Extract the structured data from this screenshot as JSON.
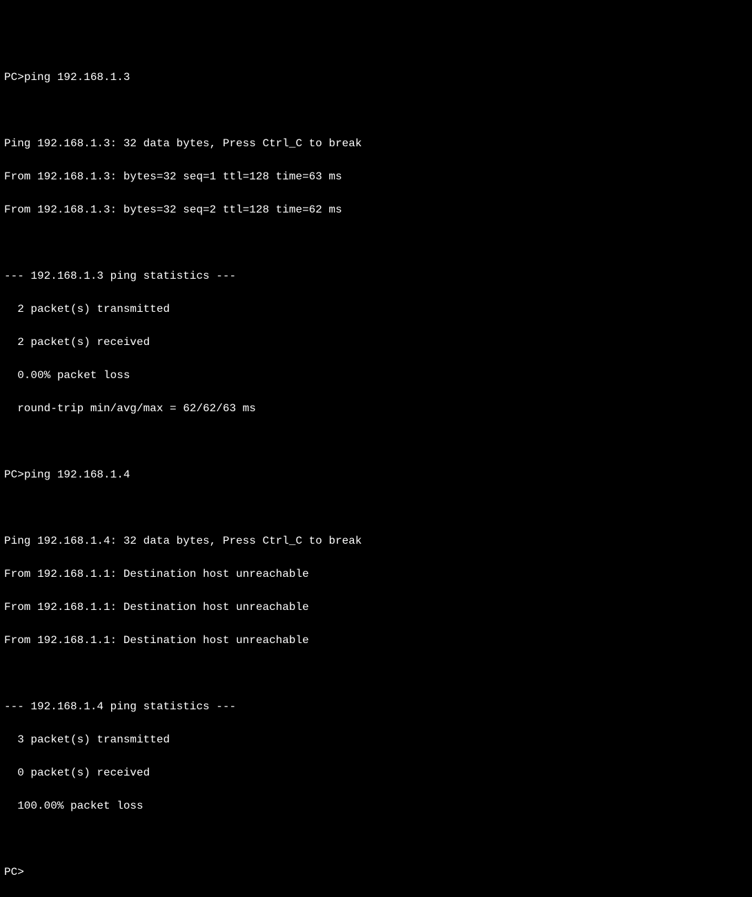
{
  "terminal": {
    "prompt": "PC>",
    "session1": {
      "command": "ping 192.168.1.3",
      "header": "Ping 192.168.1.3: 32 data bytes, Press Ctrl_C to break",
      "replies": [
        "From 192.168.1.3: bytes=32 seq=1 ttl=128 time=63 ms",
        "From 192.168.1.3: bytes=32 seq=2 ttl=128 time=62 ms"
      ],
      "stats_header": "--- 192.168.1.3 ping statistics ---",
      "stats": [
        "  2 packet(s) transmitted",
        "  2 packet(s) received",
        "  0.00% packet loss",
        "  round-trip min/avg/max = 62/62/63 ms"
      ]
    },
    "session2": {
      "command": "ping 192.168.1.4",
      "header": "Ping 192.168.1.4: 32 data bytes, Press Ctrl_C to break",
      "replies": [
        "From 192.168.1.1: Destination host unreachable",
        "From 192.168.1.1: Destination host unreachable",
        "From 192.168.1.1: Destination host unreachable"
      ],
      "stats_header": "--- 192.168.1.4 ping statistics ---",
      "stats": [
        "  3 packet(s) transmitted",
        "  0 packet(s) received",
        "  100.00% packet loss"
      ]
    }
  }
}
